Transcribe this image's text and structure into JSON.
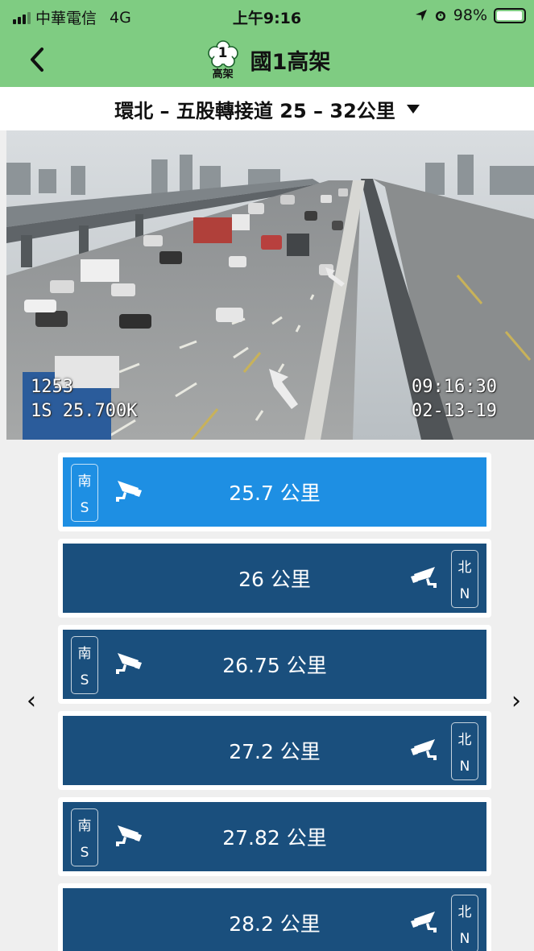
{
  "status": {
    "carrier": "中華電信",
    "network": "4G",
    "time": "上午9:16",
    "battery": "98%",
    "battery_level": 0.98
  },
  "nav": {
    "back_icon": "chevron-left-icon",
    "logo_number": "1",
    "logo_text": "高架",
    "title": "國1高架"
  },
  "section": {
    "title": "環北 – 五股轉接道 25 – 32公里",
    "dropdown_icon": "triangle-down-icon"
  },
  "camera": {
    "id": "1253",
    "location": "1S  25.700K",
    "time": "09:16:30",
    "date": "02-13-19"
  },
  "list": {
    "prev_icon": "‹",
    "next_icon": "›",
    "items": [
      {
        "km": "25.7 公里",
        "dir_zh": "南",
        "dir_en": "S",
        "side": "left",
        "active": true
      },
      {
        "km": "26 公里",
        "dir_zh": "北",
        "dir_en": "N",
        "side": "right",
        "active": false
      },
      {
        "km": "26.75 公里",
        "dir_zh": "南",
        "dir_en": "S",
        "side": "left",
        "active": false
      },
      {
        "km": "27.2 公里",
        "dir_zh": "北",
        "dir_en": "N",
        "side": "right",
        "active": false
      },
      {
        "km": "27.82 公里",
        "dir_zh": "南",
        "dir_en": "S",
        "side": "left",
        "active": false
      },
      {
        "km": "28.2 公里",
        "dir_zh": "北",
        "dir_en": "N",
        "side": "right",
        "active": false
      }
    ]
  },
  "colors": {
    "header_green": "#7fcc82",
    "card_active": "#1e8fe3",
    "card_default": "#1a4f7d"
  }
}
